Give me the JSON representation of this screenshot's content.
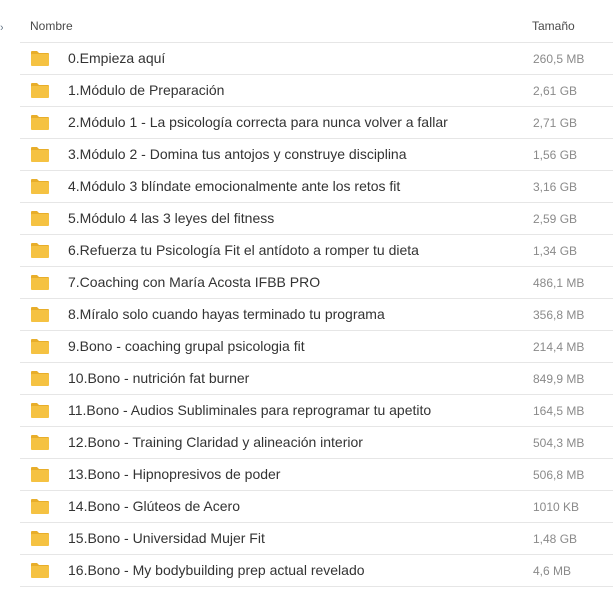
{
  "edge_glyph": "›",
  "header": {
    "name_label": "Nombre",
    "size_label": "Tamaño"
  },
  "folder_icon": {
    "icon": "folder-icon",
    "color": "#F5C242",
    "tab_color": "#E8AE2A"
  },
  "items": [
    {
      "name": "0.Empieza aquí",
      "size": "260,5 MB"
    },
    {
      "name": "1.Módulo de Preparación",
      "size": "2,61 GB"
    },
    {
      "name": "2.Módulo 1 - La psicología correcta para nunca volver a fallar",
      "size": "2,71 GB"
    },
    {
      "name": "3.Módulo 2 - Domina tus antojos y construye disciplina",
      "size": "1,56 GB"
    },
    {
      "name": "4.Módulo 3 blíndate emocionalmente ante los retos fit",
      "size": "3,16 GB"
    },
    {
      "name": "5.Módulo 4 las 3 leyes del fitness",
      "size": "2,59 GB"
    },
    {
      "name": "6.Refuerza tu Psicología Fit el antídoto a romper tu dieta",
      "size": "1,34 GB"
    },
    {
      "name": "7.Coaching con María Acosta IFBB PRO",
      "size": "486,1 MB"
    },
    {
      "name": "8.Míralo solo cuando hayas terminado tu programa",
      "size": "356,8 MB"
    },
    {
      "name": "9.Bono - coaching grupal psicologia fit",
      "size": "214,4 MB"
    },
    {
      "name": "10.Bono - nutrición fat burner",
      "size": "849,9 MB"
    },
    {
      "name": "11.Bono - Audios Subliminales para reprogramar tu apetito",
      "size": "164,5 MB"
    },
    {
      "name": "12.Bono - Training Claridad y alineación interior",
      "size": "504,3 MB"
    },
    {
      "name": "13.Bono - Hipnopresivos de poder",
      "size": "506,8 MB"
    },
    {
      "name": "14.Bono - Glúteos de Acero",
      "size": "1010 KB"
    },
    {
      "name": "15.Bono - Universidad Mujer Fit",
      "size": "1,48 GB"
    },
    {
      "name": "16.Bono - My bodybuilding prep actual revelado",
      "size": "4,6 MB"
    }
  ]
}
